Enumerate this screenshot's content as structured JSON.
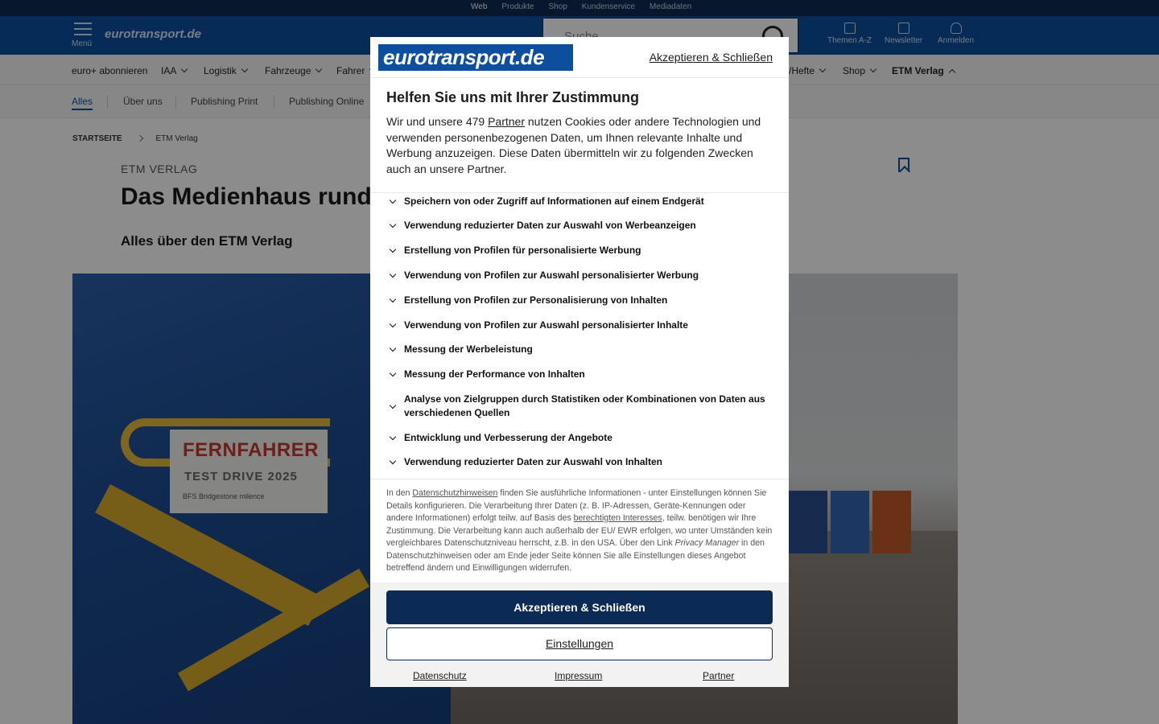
{
  "top_strip": {
    "links": [
      "Web",
      "Produkte",
      "Shop",
      "Kundenservice",
      "Mediadaten"
    ]
  },
  "header": {
    "menu_label": "Menü",
    "logo": "eurotransport.de",
    "search_placeholder": "Suche",
    "icons": [
      {
        "label": "Themen A-Z",
        "icon": "document-icon"
      },
      {
        "label": "Newsletter",
        "icon": "mail-icon"
      },
      {
        "label": "Anmelden",
        "icon": "user-icon"
      }
    ]
  },
  "nav": {
    "items": [
      {
        "label": "euro+ abonnieren"
      },
      {
        "label": "IAA"
      },
      {
        "label": "Logistik"
      },
      {
        "label": "Fahrzeuge"
      },
      {
        "label": "Fahrer"
      },
      {
        "label": "/Hefte"
      },
      {
        "label": "Shop"
      },
      {
        "label": "ETM Verlag"
      }
    ]
  },
  "subnav": {
    "items": [
      "Alles",
      "Über uns",
      "Publishing Print",
      "Publishing Online"
    ]
  },
  "breadcrumb": {
    "home": "STARTSEITE",
    "current": "ETM Verlag"
  },
  "article": {
    "kicker": "ETM VERLAG",
    "title": "Das Medienhaus rund u",
    "subtitle": "Alles über den ETM Verlag"
  },
  "hero": {
    "sticker_title": "FERNFAHRER",
    "sticker_sub": "TEST DRIVE 2025",
    "sticker_sponsors": "BFS     Bridgestone     milence"
  },
  "consent": {
    "logo": "eurotransport.de",
    "accept_link": "Akzeptieren & Schließen",
    "heading": "Helfen Sie uns mit Ihrer Zustimmung",
    "intro_before": "Wir und unsere 479 ",
    "intro_link": "Partner",
    "intro_after": " nutzen Cookies oder andere Technologien und verwenden personenbezogenen Daten, um Ihnen relevante Inhalte und Werbung anzuzeigen. Diese Daten übermitteln wir zu folgenden Zwecken auch an unsere Partner.",
    "purposes": [
      "Speichern von oder Zugriff auf Informationen auf einem Endgerät",
      "Verwendung reduzierter Daten zur Auswahl von Werbeanzeigen",
      "Erstellung von Profilen für personalisierte Werbung",
      "Verwendung von Profilen zur Auswahl personalisierter Werbung",
      "Erstellung von Profilen zur Personalisierung von Inhalten",
      "Verwendung von Profilen zur Auswahl personalisierter Inhalte",
      "Messung der Werbeleistung",
      "Messung der Performance von Inhalten",
      "Analyse von Zielgruppen durch Statistiken oder Kombinationen von Daten aus verschiedenen Quellen",
      "Entwicklung und Verbesserung der Angebote",
      "Verwendung reduzierter Daten zur Auswahl von Inhalten"
    ],
    "small_1": "In den ",
    "small_link_1": "Datenschutzhinweisen",
    "small_2": " finden Sie ausführliche Informationen - unter Einstellungen können Sie Details konfigurieren. Die Verarbeitung Ihrer Daten (z. B. IP-Adressen, Geräte-Kennungen oder andere Informationen) erfolgt teilw. auf Basis des ",
    "small_link_2": "berechtigten Interesses",
    "small_3": ", teilw. benötigen wir Ihre Zustimmung. Die Verarbeitung kann auch außerhalb der EU/ EWR erfolgen, wo unter Umständen kein vergleichbares Datenschutzniveau herrscht, z.B. in den USA. Über den Link ",
    "small_em": "Privacy Manager",
    "small_4": " in den Datenschutzhinweisen oder am Ende jeder Seite können Sie alle Einstellungen dieses Angebot betreffend ändern und Einwilligungen widerrufen.",
    "primary_button": "Akzeptieren & Schließen",
    "secondary_button": "Einstellungen",
    "footer_links": [
      "Datenschutz",
      "Impressum",
      "Partner"
    ]
  },
  "colors": {
    "brand_blue": "#0d4f9e",
    "dark_navy": "#0b2a55",
    "overlay": "rgba(0,0,0,0.45)"
  }
}
